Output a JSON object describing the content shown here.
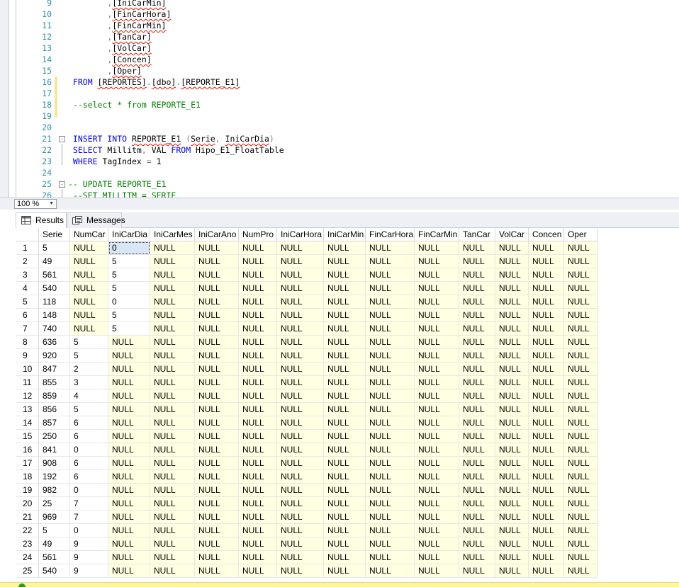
{
  "editor": {
    "lines": [
      {
        "n": "9",
        "segs": [
          {
            "t": "        ,",
            "c": "g"
          },
          {
            "t": "[IniCarMin]",
            "sq": true
          }
        ]
      },
      {
        "n": "10",
        "segs": [
          {
            "t": "        ,",
            "c": "g"
          },
          {
            "t": "[FinCarHora]",
            "sq": true
          }
        ]
      },
      {
        "n": "11",
        "segs": [
          {
            "t": "        ,",
            "c": "g"
          },
          {
            "t": "[FinCarMin]",
            "sq": true
          }
        ]
      },
      {
        "n": "12",
        "segs": [
          {
            "t": "        ,",
            "c": "g"
          },
          {
            "t": "[TanCar]",
            "sq": true
          }
        ]
      },
      {
        "n": "13",
        "segs": [
          {
            "t": "        ,",
            "c": "g"
          },
          {
            "t": "[VolCar]",
            "sq": true
          }
        ]
      },
      {
        "n": "14",
        "segs": [
          {
            "t": "        ,",
            "c": "g"
          },
          {
            "t": "[Concen]",
            "sq": true
          }
        ]
      },
      {
        "n": "15",
        "segs": [
          {
            "t": "        ,",
            "c": "g"
          },
          {
            "t": "[Oper]",
            "sq": true
          }
        ]
      },
      {
        "n": "16",
        "segs": [
          {
            "t": " FROM ",
            "c": "k"
          },
          {
            "t": "[REPORTES]",
            "sq": true
          },
          {
            "t": ".",
            "c": "g"
          },
          {
            "t": "[dbo]",
            "sq": true
          },
          {
            "t": ".",
            "c": "g"
          },
          {
            "t": "[REPORTE_E1]",
            "sq": true
          }
        ]
      },
      {
        "n": "17",
        "segs": []
      },
      {
        "n": "18",
        "segs": [
          {
            "t": " --select * from REPORTE_E1",
            "c": "c"
          }
        ]
      },
      {
        "n": "19",
        "segs": []
      },
      {
        "n": "20",
        "segs": []
      },
      {
        "n": "21",
        "fold": "-",
        "segs": [
          {
            "t": " INSERT INTO ",
            "c": "k"
          },
          {
            "t": "REPORTE_E1",
            "sq": true
          },
          {
            "t": " (",
            "c": "g"
          },
          {
            "t": "Serie",
            "sq": true
          },
          {
            "t": ", ",
            "c": "g"
          },
          {
            "t": "IniCarDia",
            "sq": true
          },
          {
            "t": ")",
            "c": "g"
          }
        ]
      },
      {
        "n": "22",
        "segs": [
          {
            "t": " SELECT ",
            "c": "k"
          },
          {
            "t": "Millitm"
          },
          {
            "t": ", ",
            "c": "g"
          },
          {
            "t": "VAL "
          },
          {
            "t": "FROM ",
            "c": "k"
          },
          {
            "t": "Hipo_E1_FloatTable"
          }
        ]
      },
      {
        "n": "23",
        "segs": [
          {
            "t": " WHERE ",
            "c": "k"
          },
          {
            "t": "TagIndex "
          },
          {
            "t": "= ",
            "c": "g"
          },
          {
            "t": "1"
          }
        ]
      },
      {
        "n": "24",
        "segs": []
      },
      {
        "n": "25",
        "fold": "-",
        "segs": [
          {
            "t": "-- UPDATE REPORTE_E1",
            "c": "c"
          }
        ]
      },
      {
        "n": "26",
        "segs": [
          {
            "t": " --SET MILLITM = SERIE",
            "c": "c"
          }
        ]
      }
    ]
  },
  "zoom": {
    "value": "100 %"
  },
  "tabs": [
    {
      "label": "Results",
      "icon": "results-grid-icon",
      "active": true
    },
    {
      "label": "Messages",
      "icon": "messages-icon",
      "active": false
    }
  ],
  "grid": {
    "columns": [
      "Serie",
      "NumCar",
      "IniCarDia",
      "IniCarMes",
      "IniCarAno",
      "NumPro",
      "IniCarHora",
      "IniCarMin",
      "FinCarHora",
      "FinCarMin",
      "TanCar",
      "VolCar",
      "Concen",
      "Oper"
    ],
    "rows": [
      [
        "1",
        "5",
        "NULL",
        "0",
        "NULL",
        "NULL",
        "NULL",
        "NULL",
        "NULL",
        "NULL",
        "NULL",
        "NULL",
        "NULL",
        "NULL",
        "NULL"
      ],
      [
        "2",
        "49",
        "NULL",
        "5",
        "NULL",
        "NULL",
        "NULL",
        "NULL",
        "NULL",
        "NULL",
        "NULL",
        "NULL",
        "NULL",
        "NULL",
        "NULL"
      ],
      [
        "3",
        "561",
        "NULL",
        "5",
        "NULL",
        "NULL",
        "NULL",
        "NULL",
        "NULL",
        "NULL",
        "NULL",
        "NULL",
        "NULL",
        "NULL",
        "NULL"
      ],
      [
        "4",
        "540",
        "NULL",
        "5",
        "NULL",
        "NULL",
        "NULL",
        "NULL",
        "NULL",
        "NULL",
        "NULL",
        "NULL",
        "NULL",
        "NULL",
        "NULL"
      ],
      [
        "5",
        "118",
        "NULL",
        "0",
        "NULL",
        "NULL",
        "NULL",
        "NULL",
        "NULL",
        "NULL",
        "NULL",
        "NULL",
        "NULL",
        "NULL",
        "NULL"
      ],
      [
        "6",
        "148",
        "NULL",
        "5",
        "NULL",
        "NULL",
        "NULL",
        "NULL",
        "NULL",
        "NULL",
        "NULL",
        "NULL",
        "NULL",
        "NULL",
        "NULL"
      ],
      [
        "7",
        "740",
        "NULL",
        "5",
        "NULL",
        "NULL",
        "NULL",
        "NULL",
        "NULL",
        "NULL",
        "NULL",
        "NULL",
        "NULL",
        "NULL",
        "NULL"
      ],
      [
        "8",
        "636",
        "5",
        "NULL",
        "NULL",
        "NULL",
        "NULL",
        "NULL",
        "NULL",
        "NULL",
        "NULL",
        "NULL",
        "NULL",
        "NULL",
        "NULL"
      ],
      [
        "9",
        "920",
        "5",
        "NULL",
        "NULL",
        "NULL",
        "NULL",
        "NULL",
        "NULL",
        "NULL",
        "NULL",
        "NULL",
        "NULL",
        "NULL",
        "NULL"
      ],
      [
        "10",
        "847",
        "2",
        "NULL",
        "NULL",
        "NULL",
        "NULL",
        "NULL",
        "NULL",
        "NULL",
        "NULL",
        "NULL",
        "NULL",
        "NULL",
        "NULL"
      ],
      [
        "11",
        "855",
        "3",
        "NULL",
        "NULL",
        "NULL",
        "NULL",
        "NULL",
        "NULL",
        "NULL",
        "NULL",
        "NULL",
        "NULL",
        "NULL",
        "NULL"
      ],
      [
        "12",
        "859",
        "4",
        "NULL",
        "NULL",
        "NULL",
        "NULL",
        "NULL",
        "NULL",
        "NULL",
        "NULL",
        "NULL",
        "NULL",
        "NULL",
        "NULL"
      ],
      [
        "13",
        "856",
        "5",
        "NULL",
        "NULL",
        "NULL",
        "NULL",
        "NULL",
        "NULL",
        "NULL",
        "NULL",
        "NULL",
        "NULL",
        "NULL",
        "NULL"
      ],
      [
        "14",
        "857",
        "6",
        "NULL",
        "NULL",
        "NULL",
        "NULL",
        "NULL",
        "NULL",
        "NULL",
        "NULL",
        "NULL",
        "NULL",
        "NULL",
        "NULL"
      ],
      [
        "15",
        "250",
        "6",
        "NULL",
        "NULL",
        "NULL",
        "NULL",
        "NULL",
        "NULL",
        "NULL",
        "NULL",
        "NULL",
        "NULL",
        "NULL",
        "NULL"
      ],
      [
        "16",
        "841",
        "0",
        "NULL",
        "NULL",
        "NULL",
        "NULL",
        "NULL",
        "NULL",
        "NULL",
        "NULL",
        "NULL",
        "NULL",
        "NULL",
        "NULL"
      ],
      [
        "17",
        "908",
        "6",
        "NULL",
        "NULL",
        "NULL",
        "NULL",
        "NULL",
        "NULL",
        "NULL",
        "NULL",
        "NULL",
        "NULL",
        "NULL",
        "NULL"
      ],
      [
        "18",
        "192",
        "6",
        "NULL",
        "NULL",
        "NULL",
        "NULL",
        "NULL",
        "NULL",
        "NULL",
        "NULL",
        "NULL",
        "NULL",
        "NULL",
        "NULL"
      ],
      [
        "19",
        "982",
        "0",
        "NULL",
        "NULL",
        "NULL",
        "NULL",
        "NULL",
        "NULL",
        "NULL",
        "NULL",
        "NULL",
        "NULL",
        "NULL",
        "NULL"
      ],
      [
        "20",
        "25",
        "7",
        "NULL",
        "NULL",
        "NULL",
        "NULL",
        "NULL",
        "NULL",
        "NULL",
        "NULL",
        "NULL",
        "NULL",
        "NULL",
        "NULL"
      ],
      [
        "21",
        "969",
        "7",
        "NULL",
        "NULL",
        "NULL",
        "NULL",
        "NULL",
        "NULL",
        "NULL",
        "NULL",
        "NULL",
        "NULL",
        "NULL",
        "NULL"
      ],
      [
        "22",
        "5",
        "0",
        "NULL",
        "NULL",
        "NULL",
        "NULL",
        "NULL",
        "NULL",
        "NULL",
        "NULL",
        "NULL",
        "NULL",
        "NULL",
        "NULL"
      ],
      [
        "23",
        "49",
        "9",
        "NULL",
        "NULL",
        "NULL",
        "NULL",
        "NULL",
        "NULL",
        "NULL",
        "NULL",
        "NULL",
        "NULL",
        "NULL",
        "NULL"
      ],
      [
        "24",
        "561",
        "9",
        "NULL",
        "NULL",
        "NULL",
        "NULL",
        "NULL",
        "NULL",
        "NULL",
        "NULL",
        "NULL",
        "NULL",
        "NULL",
        "NULL"
      ],
      [
        "25",
        "540",
        "9",
        "NULL",
        "NULL",
        "NULL",
        "NULL",
        "NULL",
        "NULL",
        "NULL",
        "NULL",
        "NULL",
        "NULL",
        "NULL",
        "NULL"
      ]
    ],
    "selected": {
      "row": 0,
      "col": 3
    }
  },
  "status": {
    "icon": "status-success-icon"
  },
  "colors": {
    "null_bg": "#ffffe1",
    "keyword": "#0000ff",
    "comment": "#008000",
    "line_number": "#2b91af",
    "status_bar": "#fff59d"
  }
}
